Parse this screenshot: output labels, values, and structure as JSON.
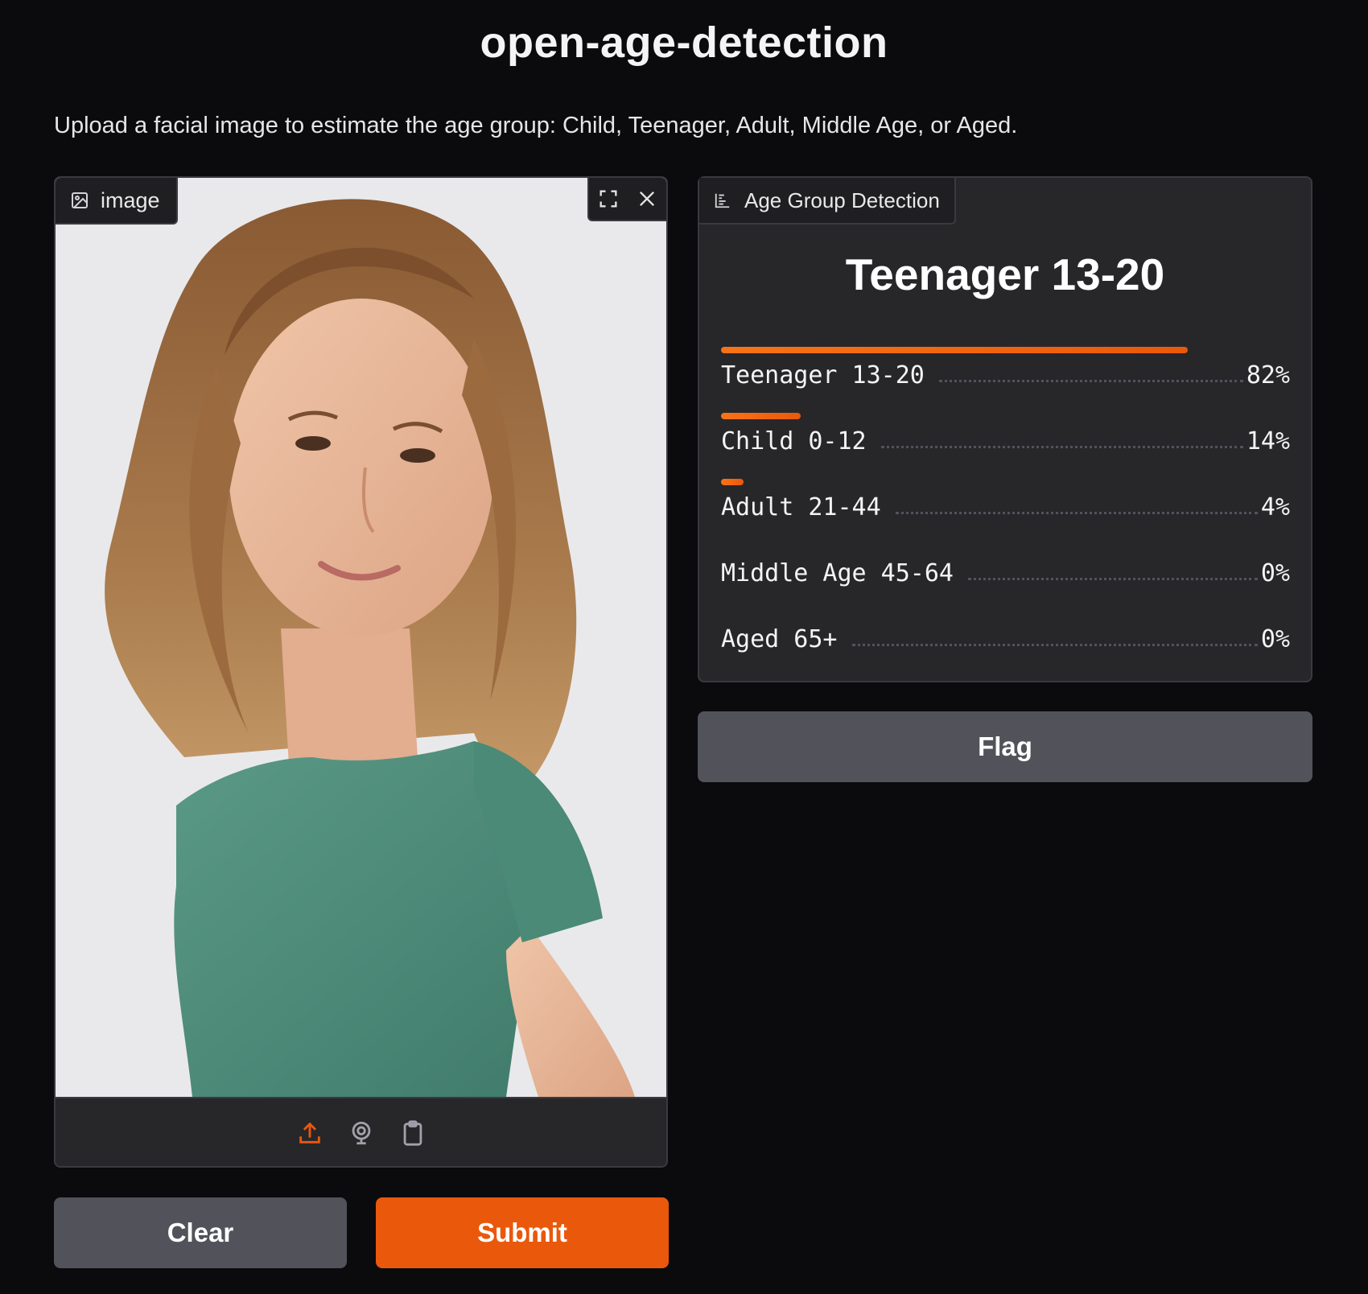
{
  "app": {
    "title": "open-age-detection",
    "description": "Upload a facial image to estimate the age group: Child, Teenager, Adult, Middle Age, or Aged."
  },
  "input": {
    "tab_label": "image",
    "icons": {
      "tab": "image-icon",
      "fullscreen": "fullscreen-icon",
      "clear": "close-icon",
      "upload": "upload-icon",
      "webcam": "webcam-icon",
      "clipboard": "clipboard-icon"
    }
  },
  "output": {
    "tab_label": "Age Group Detection",
    "label": "Teenager 13-20",
    "confidences": [
      {
        "label": "Teenager 13-20",
        "percent": "82%",
        "value": 0.82
      },
      {
        "label": "Child 0-12",
        "percent": "14%",
        "value": 0.14
      },
      {
        "label": "Adult 21-44",
        "percent": "4%",
        "value": 0.04
      },
      {
        "label": "Middle Age 45-64",
        "percent": "0%",
        "value": 0.0
      },
      {
        "label": "Aged 65+",
        "percent": "0%",
        "value": 0.0
      }
    ]
  },
  "buttons": {
    "clear": "Clear",
    "submit": "Submit",
    "flag": "Flag"
  },
  "colors": {
    "background": "#0b0b0d",
    "panel": "#27272a",
    "accent": "#ea580c",
    "secondary_button": "#52525b"
  }
}
